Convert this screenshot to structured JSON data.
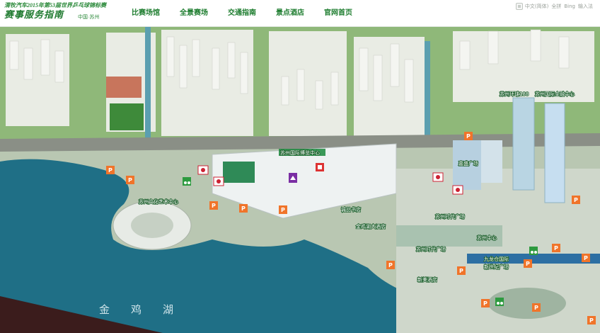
{
  "header": {
    "subtitle": "渭牧汽车2015年第53届世界乒乓球锦标赛",
    "title": "赛事服务指南",
    "location": "中国·苏州"
  },
  "nav": {
    "items": [
      {
        "label": "比赛场馆"
      },
      {
        "label": "全景赛场"
      },
      {
        "label": "交通指南"
      },
      {
        "label": "景点酒店"
      },
      {
        "label": "官网首页"
      }
    ]
  },
  "ime": {
    "items": [
      "中文(简体)",
      "全拼",
      "Bing",
      "输入法"
    ]
  },
  "map": {
    "lake_label": "金　　鸡　　湖",
    "places": [
      {
        "name": "苏州国际博览中心"
      },
      {
        "name": "苏州文化艺术中心"
      },
      {
        "name": "苏州国际金融中心"
      },
      {
        "name": "苏州环球188"
      },
      {
        "name": "嘉盛广场"
      },
      {
        "name": "苏州时代广场"
      },
      {
        "name": "诚品书店"
      },
      {
        "name": "苏州中心"
      },
      {
        "name": "金鸡湖大酒店"
      },
      {
        "name": "苏州时代广场"
      },
      {
        "name": "新美酒店"
      },
      {
        "name": "新世纪广场"
      },
      {
        "name": "九龙仓国际"
      }
    ],
    "parking_symbol": "P",
    "colors": {
      "water": "#1f6f86",
      "land": "#c9d3c2",
      "park": "#7cb35a",
      "parking": "#f0742a",
      "accent": "#1e7d2f"
    }
  }
}
